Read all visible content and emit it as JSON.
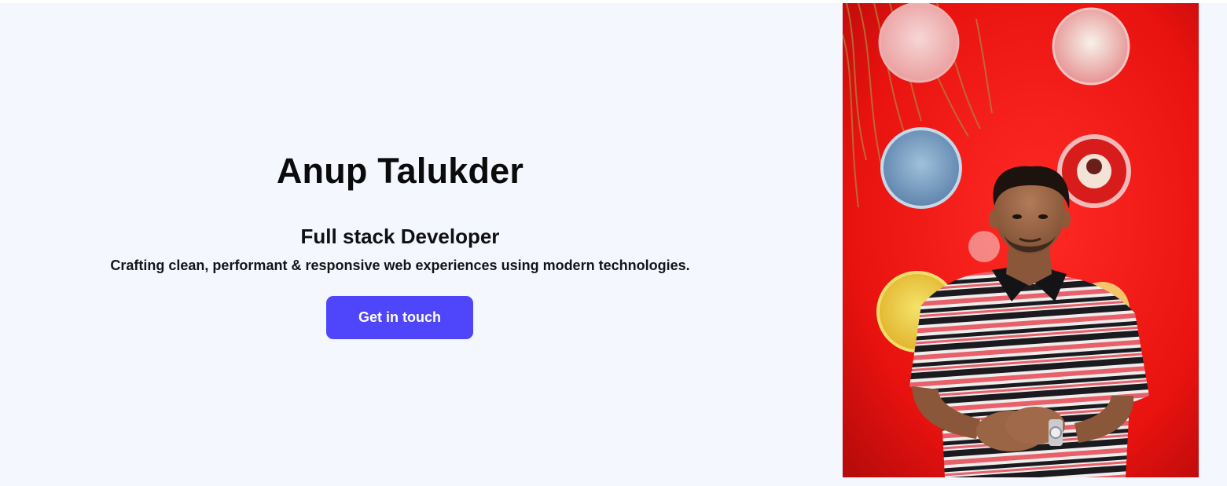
{
  "hero": {
    "name": "Anup Talukder",
    "role": "Full stack Developer",
    "tagline": "Crafting clean, performant & responsive web experiences using modern technologies.",
    "cta_label": "Get in touch"
  },
  "colors": {
    "page_background": "#f4f7fd",
    "accent": "#4f46fb",
    "photo_backdrop": "#ec1a1a"
  }
}
